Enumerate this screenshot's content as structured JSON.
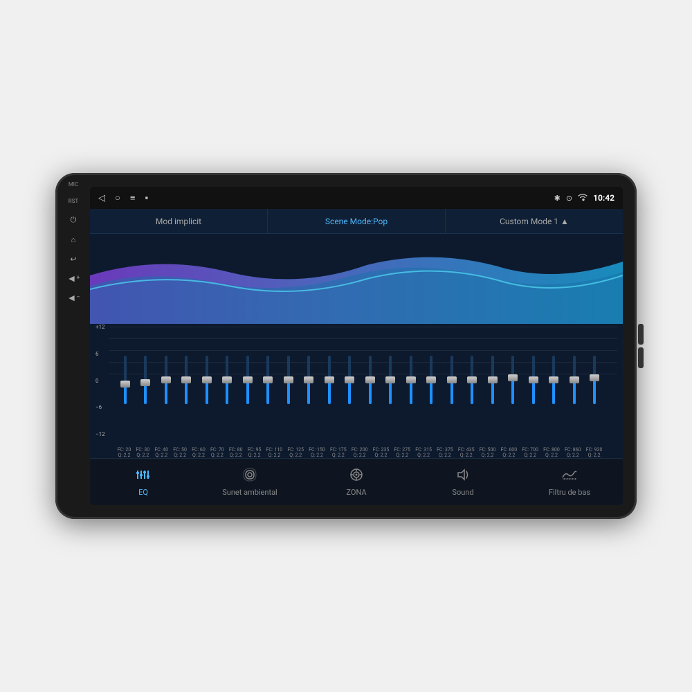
{
  "device": {
    "time": "10:42"
  },
  "statusBar": {
    "navIcons": [
      "◁",
      "○",
      "≡",
      "⬛"
    ],
    "rightIcons": [
      "✱",
      "⊙",
      "WiFi"
    ],
    "time": "10:42"
  },
  "modeBar": {
    "items": [
      {
        "label": "Mod implicit",
        "active": false
      },
      {
        "label": "Scene Mode:Pop",
        "active": true
      },
      {
        "label": "Custom Mode 1 ▲",
        "active": false
      }
    ]
  },
  "equalizerGridLabels": [
    "+12",
    "6",
    "0",
    "−6",
    "−12"
  ],
  "sliders": [
    {
      "fc": "20",
      "q": "2.2",
      "fillPct": 42
    },
    {
      "fc": "30",
      "q": "2.2",
      "fillPct": 45
    },
    {
      "fc": "40",
      "q": "2.2",
      "fillPct": 50
    },
    {
      "fc": "50",
      "q": "2.2",
      "fillPct": 50
    },
    {
      "fc": "60",
      "q": "2.2",
      "fillPct": 50
    },
    {
      "fc": "70",
      "q": "2.2",
      "fillPct": 50
    },
    {
      "fc": "80",
      "q": "2.2",
      "fillPct": 50
    },
    {
      "fc": "95",
      "q": "2.2",
      "fillPct": 50
    },
    {
      "fc": "110",
      "q": "2.2",
      "fillPct": 50
    },
    {
      "fc": "125",
      "q": "2.2",
      "fillPct": 50
    },
    {
      "fc": "150",
      "q": "2.2",
      "fillPct": 50
    },
    {
      "fc": "175",
      "q": "2.2",
      "fillPct": 50
    },
    {
      "fc": "200",
      "q": "2.2",
      "fillPct": 50
    },
    {
      "fc": "235",
      "q": "2.2",
      "fillPct": 50
    },
    {
      "fc": "275",
      "q": "2.2",
      "fillPct": 50
    },
    {
      "fc": "315",
      "q": "2.2",
      "fillPct": 50
    },
    {
      "fc": "375",
      "q": "2.2",
      "fillPct": 50
    },
    {
      "fc": "435",
      "q": "2.2",
      "fillPct": 50
    },
    {
      "fc": "500",
      "q": "2.2",
      "fillPct": 50
    },
    {
      "fc": "600",
      "q": "2.2",
      "fillPct": 55
    },
    {
      "fc": "700",
      "q": "2.2",
      "fillPct": 50
    },
    {
      "fc": "800",
      "q": "2.2",
      "fillPct": 50
    },
    {
      "fc": "860",
      "q": "2.2",
      "fillPct": 50
    },
    {
      "fc": "920",
      "q": "2.2",
      "fillPct": 55
    }
  ],
  "bottomNav": [
    {
      "label": "EQ",
      "icon": "sliders",
      "active": true
    },
    {
      "label": "Sunet ambiental",
      "icon": "ambient",
      "active": false
    },
    {
      "label": "ZONA",
      "icon": "zone",
      "active": false
    },
    {
      "label": "Sound",
      "icon": "sound",
      "active": false
    },
    {
      "label": "Filtru de bas",
      "icon": "bass",
      "active": false
    }
  ],
  "leftPanelIcons": [
    {
      "name": "rst",
      "label": "RST"
    },
    {
      "name": "power",
      "symbol": "⏻"
    },
    {
      "name": "home",
      "symbol": "⌂"
    },
    {
      "name": "back",
      "symbol": "↩"
    },
    {
      "name": "vol-up",
      "symbol": "◄+"
    },
    {
      "name": "vol-down",
      "symbol": "◄-"
    }
  ]
}
